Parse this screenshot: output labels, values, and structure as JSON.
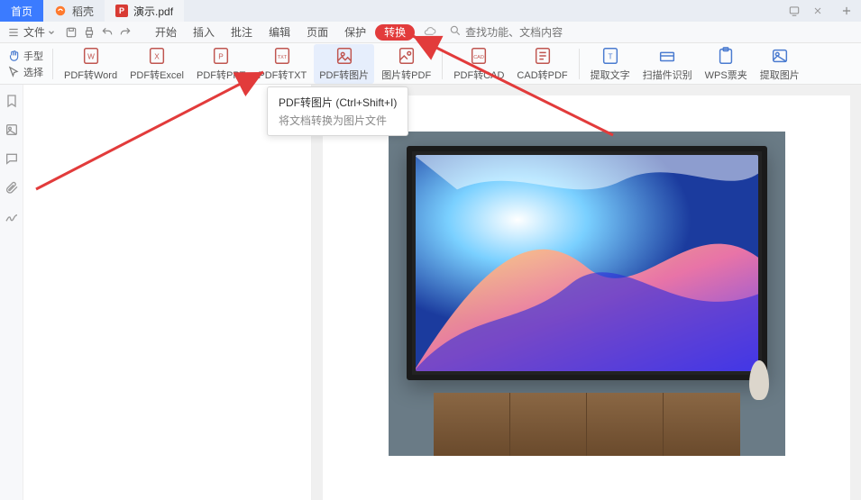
{
  "tabs": {
    "home": "首页",
    "shell": "稻壳",
    "doc": "演示.pdf"
  },
  "menubar": {
    "file": "文件",
    "items": [
      "开始",
      "插入",
      "批注",
      "编辑",
      "页面",
      "保护",
      "转换"
    ],
    "active_index": 6,
    "search_placeholder": "查找功能、文档内容"
  },
  "sidecol": {
    "hand": "手型",
    "select": "选择"
  },
  "ribbon": [
    {
      "id": "pdf-word",
      "label": "PDF转Word"
    },
    {
      "id": "pdf-excel",
      "label": "PDF转Excel"
    },
    {
      "id": "pdf-ppt",
      "label": "PDF转PPT"
    },
    {
      "id": "pdf-txt",
      "label": "PDF转TXT"
    },
    {
      "id": "pdf-img",
      "label": "PDF转图片"
    },
    {
      "id": "img-pdf",
      "label": "图片转PDF"
    },
    {
      "id": "pdf-cad",
      "label": "PDF转CAD"
    },
    {
      "id": "cad-pdf",
      "label": "CAD转PDF"
    },
    {
      "id": "extract-text",
      "label": "提取文字"
    },
    {
      "id": "scan-ocr",
      "label": "扫描件识别"
    },
    {
      "id": "wps-form",
      "label": "WPS票夹"
    },
    {
      "id": "extract-img",
      "label": "提取图片"
    }
  ],
  "tooltip": {
    "title": "PDF转图片 (Ctrl+Shift+I)",
    "desc": "将文档转换为图片文件"
  }
}
